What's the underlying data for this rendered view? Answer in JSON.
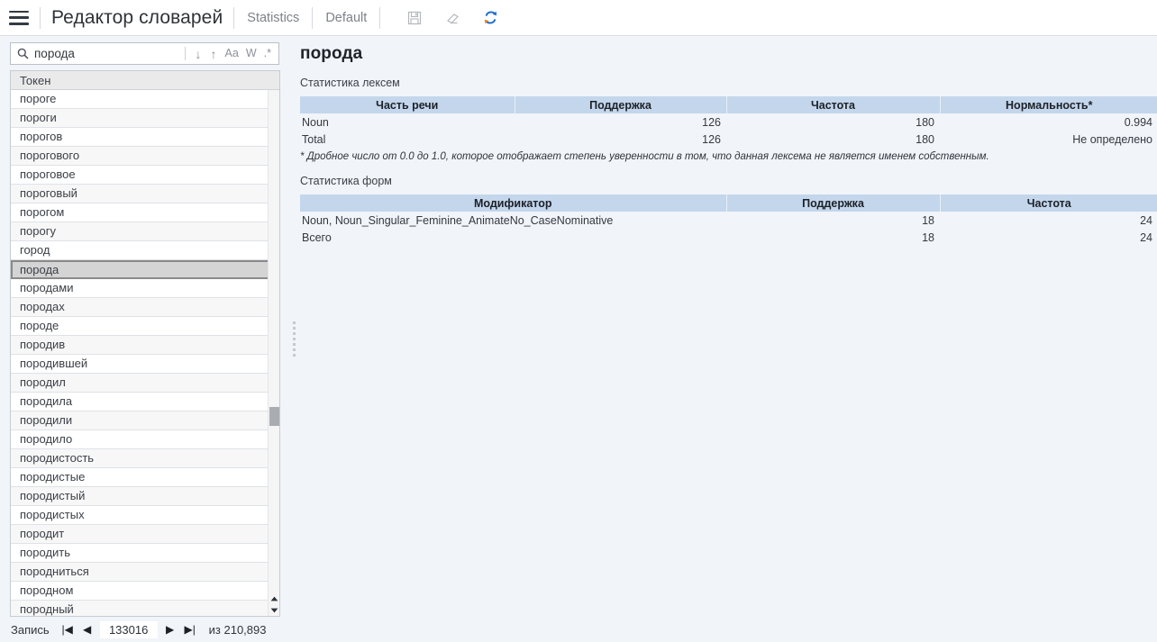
{
  "topbar": {
    "menu_icon": "hamburger-icon",
    "app_title": "Редактор словарей",
    "menu_items": [
      {
        "label": "Statistics",
        "name": "menu-statistics"
      },
      {
        "label": "Default",
        "name": "menu-default"
      }
    ],
    "tools": [
      {
        "name": "save-icon",
        "title": "save",
        "enabled": false
      },
      {
        "name": "eraser-icon",
        "title": "eraser",
        "enabled": false
      },
      {
        "name": "refresh-icon",
        "title": "refresh",
        "enabled": true
      }
    ]
  },
  "search": {
    "icon": "search-icon",
    "value": "порода",
    "placeholder": "",
    "options": [
      {
        "label": "↓",
        "name": "search-next-icon"
      },
      {
        "label": "↑",
        "name": "search-prev-icon"
      },
      {
        "label": "Aa",
        "name": "match-case-toggle"
      },
      {
        "label": "W",
        "name": "whole-word-toggle"
      },
      {
        "label": ".*",
        "name": "regex-toggle"
      }
    ]
  },
  "list": {
    "header": "Токен",
    "selected": "порода",
    "items": [
      "пороге",
      "пороги",
      "порогов",
      "порогового",
      "пороговое",
      "пороговый",
      "порогом",
      "порогу",
      "город",
      "порода",
      "породами",
      "породах",
      "породе",
      "породив",
      "породившей",
      "породил",
      "породила",
      "породили",
      "породило",
      "породистость",
      "породистые",
      "породистый",
      "породистых",
      "породит",
      "породить",
      "породниться",
      "породном",
      "породный"
    ]
  },
  "status": {
    "label": "Запись",
    "first_label": "|◀",
    "prev_label": "◀",
    "record": "133016",
    "next_label": "▶",
    "last_label": "▶|",
    "total_label": "из 210,893"
  },
  "detail": {
    "title": "порода",
    "lexeme_section_label": "Статистика лексем",
    "lexeme_table": {
      "columns": [
        "Часть речи",
        "Поддержка",
        "Частота",
        "Нормальность*"
      ],
      "rows": [
        [
          "Noun",
          "126",
          "180",
          "0.994"
        ],
        [
          "Total",
          "126",
          "180",
          "Не определено"
        ]
      ]
    },
    "footnote": "* Дробное число от 0.0 до 1.0, которое отображает степень уверенности в том, что данная лексема не является именем собственным.",
    "forms_section_label": "Статистика форм",
    "forms_table": {
      "columns": [
        "Модификатор",
        "Поддержка",
        "Частота"
      ],
      "rows": [
        [
          "Noun, Noun_Singular_Feminine_AnimateNo_CaseNominative",
          "18",
          "24"
        ],
        [
          "Всего",
          "18",
          "24"
        ]
      ]
    }
  },
  "colors": {
    "page_bg": "#f1f4f9",
    "table_header_bg": "#c3d6ec",
    "selection_bg": "#d4d4d4",
    "toolbar_bg": "#ffffff",
    "refresh_accent": "#1f6fd0"
  }
}
